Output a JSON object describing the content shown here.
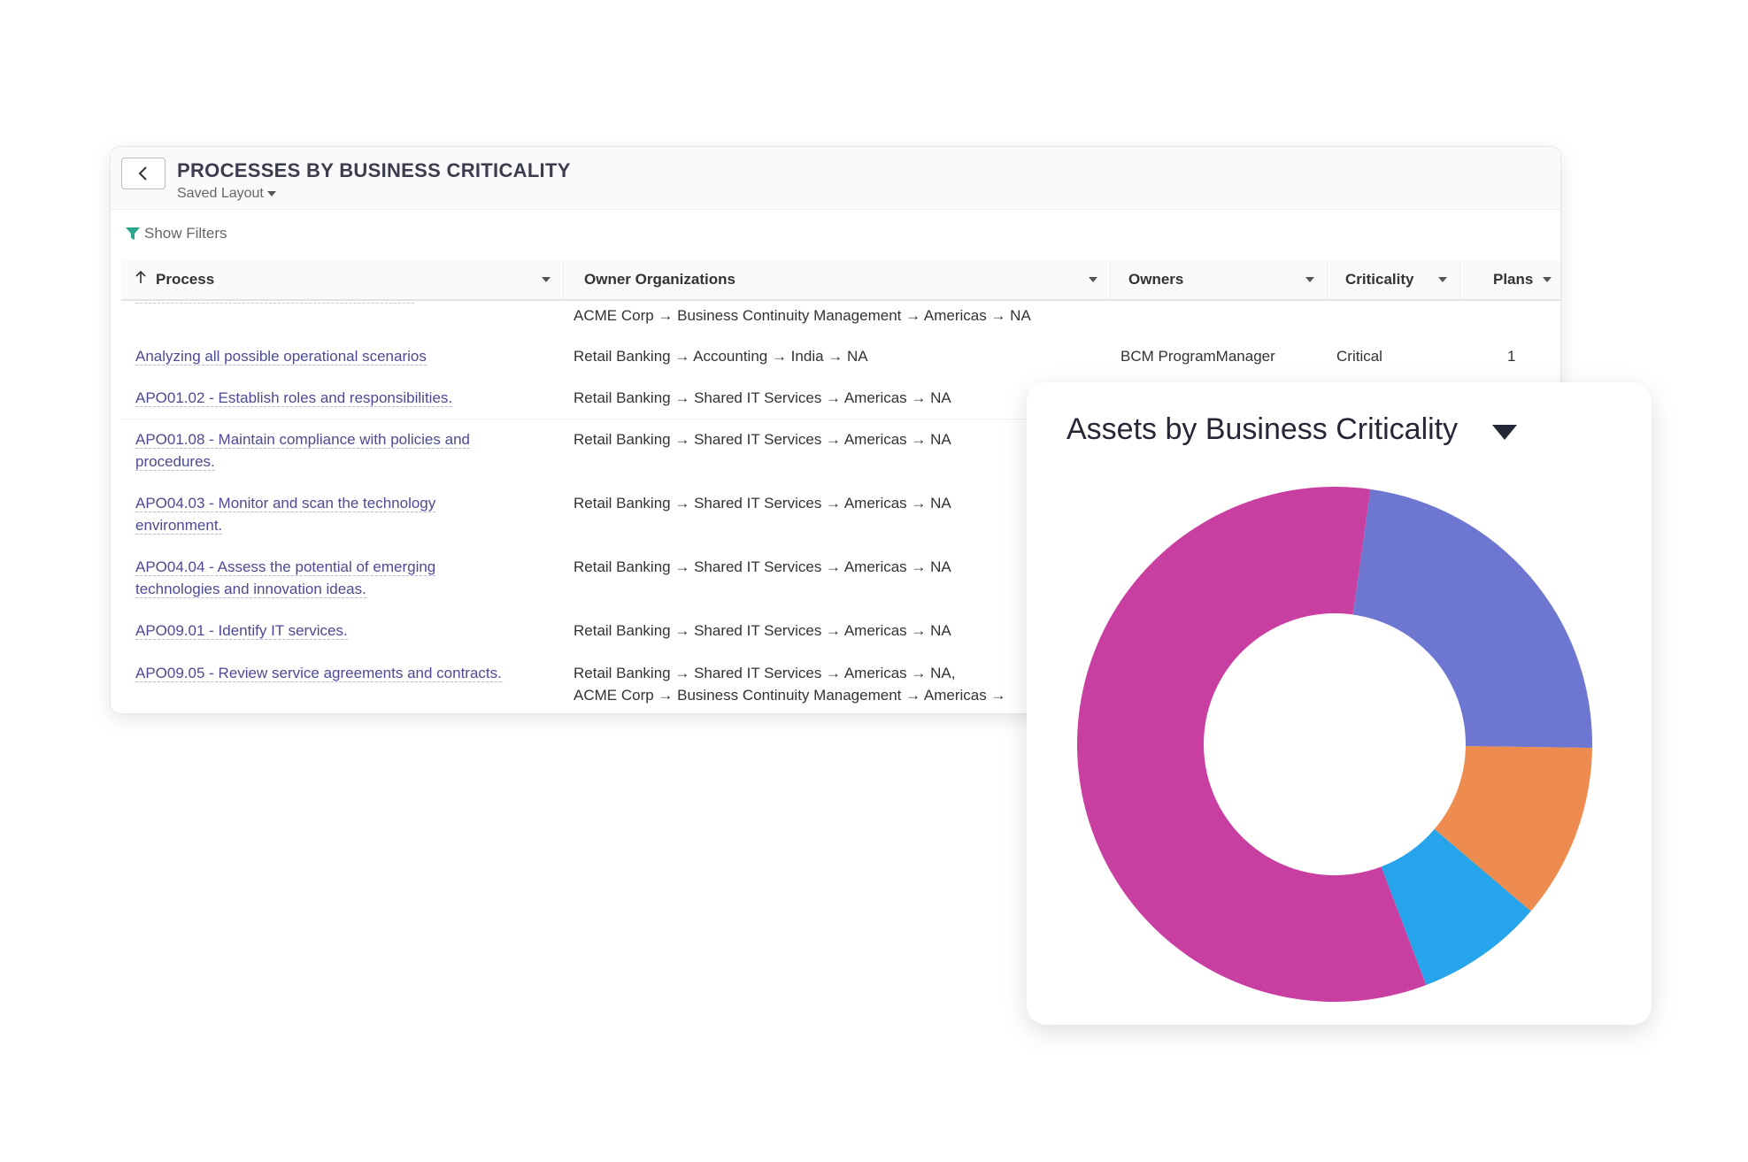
{
  "header": {
    "title": "PROCESSES BY BUSINESS CRITICALITY",
    "saved_layout": "Saved Layout"
  },
  "filters": {
    "label": "Show Filters"
  },
  "table": {
    "columns": [
      "Process",
      "Owner Organizations",
      "Owners",
      "Criticality",
      "Plans"
    ],
    "rows": [
      {
        "process": "",
        "org": "ACME Corp → Business Continuity Management → Americas → NA",
        "org2": "",
        "owners": "",
        "criticality": "",
        "plans": ""
      },
      {
        "process": "Analyzing all possible operational scenarios",
        "org": "Retail Banking → Accounting → India → NA",
        "org2": "",
        "owners": "BCM ProgramManager",
        "criticality": "Critical",
        "plans": "1"
      },
      {
        "process": "APO01.02 - Establish roles and responsibilities.",
        "org": "Retail Banking → Shared IT Services → Americas → NA",
        "org2": "",
        "owners": "",
        "criticality": "",
        "plans": ""
      },
      {
        "process": "APO01.08 - Maintain compliance with policies and",
        "process2": "procedures.",
        "org": "Retail Banking → Shared IT Services → Americas → NA",
        "org2": "",
        "owners": "",
        "criticality": "",
        "plans": ""
      },
      {
        "process": "APO04.03 - Monitor and scan the technology",
        "process2": "environment.",
        "org": "Retail Banking → Shared IT Services → Americas → NA",
        "org2": "",
        "owners": "",
        "criticality": "",
        "plans": ""
      },
      {
        "process": "APO04.04 - Assess the potential of emerging",
        "process2": "technologies and innovation ideas.",
        "org": "Retail Banking → Shared IT Services → Americas → NA",
        "org2": "",
        "owners": "",
        "criticality": "",
        "plans": ""
      },
      {
        "process": "APO09.01 - Identify IT services.",
        "org": "Retail Banking → Shared IT Services → Americas → NA",
        "org2": "",
        "owners": "",
        "criticality": "",
        "plans": ""
      },
      {
        "process": "APO09.05 - Review service agreements and contracts.",
        "org": "Retail Banking → Shared IT Services → Americas → NA,",
        "org2": "ACME Corp → Business Continuity Management → Americas →",
        "owners": "",
        "criticality": "",
        "plans": ""
      }
    ]
  },
  "chart_card": {
    "title": "Assets by Business Criticality"
  },
  "chart_data": {
    "type": "pie",
    "title": "Assets by Business Criticality",
    "donut": true,
    "slices": [
      {
        "value": 23,
        "color": "#6d77d1"
      },
      {
        "value": 11,
        "color": "#ee8b4e"
      },
      {
        "value": 8,
        "color": "#26a4ec"
      },
      {
        "value": 58,
        "color": "#c93fa1"
      }
    ],
    "start_angle_deg": 8
  }
}
